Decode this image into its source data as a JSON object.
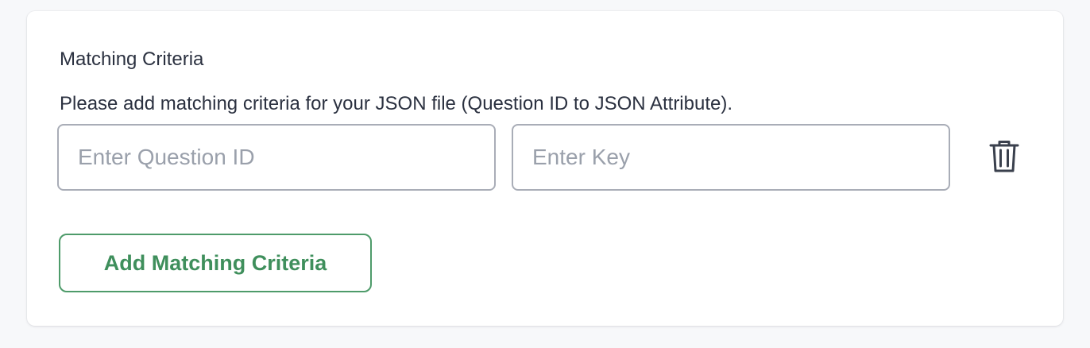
{
  "matching_criteria": {
    "title": "Matching Criteria",
    "description": "Please add matching criteria for your JSON file (Question ID to JSON Attribute).",
    "rows": [
      {
        "question_id": {
          "value": "",
          "placeholder": "Enter Question ID"
        },
        "key": {
          "value": "",
          "placeholder": "Enter Key"
        },
        "delete_icon": "trash-icon"
      }
    ],
    "add_button_label": "Add Matching Criteria"
  },
  "colors": {
    "page_background": "#f7f8fa",
    "card_background": "#ffffff",
    "text": "#2b3140",
    "placeholder": "#9aa0ab",
    "input_border": "#a9adb7",
    "accent_green": "#3f8f5c"
  }
}
